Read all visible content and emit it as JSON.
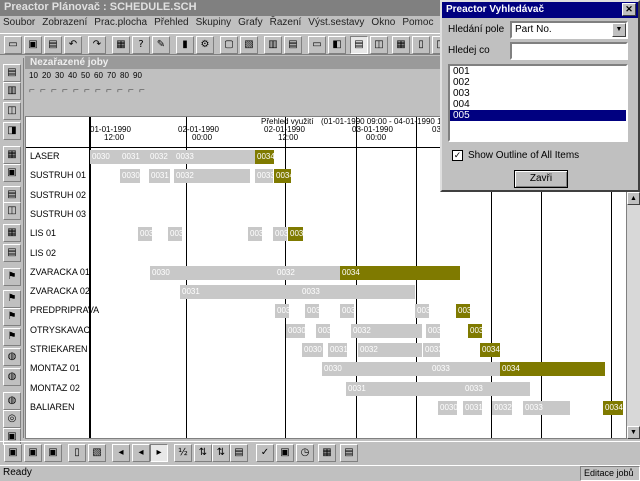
{
  "app": {
    "title": "Preactor Plánovač : SCHEDULE.SCH"
  },
  "menu": [
    "Soubor",
    "Zobrazení",
    "Prac.plocha",
    "Přehled",
    "Skupiny",
    "Grafy",
    "Řazení",
    "Výst.sestavy",
    "Okno",
    "Pomoc"
  ],
  "unscheduled": {
    "title": "Nezařazené joby",
    "ruler": [
      "10",
      "20",
      "30",
      "40",
      "50",
      "60",
      "70",
      "80",
      "90"
    ]
  },
  "gantt": {
    "header_title": "Přehled využití",
    "date_range": "(01-01-1990 09:00 - 04-01-1990 11:3",
    "dates": [
      {
        "d": "01-01-1990",
        "t": "12:00"
      },
      {
        "d": "02-01-1990",
        "t": "00:00"
      },
      {
        "d": "02-01-1990",
        "t": "12:00"
      },
      {
        "d": "03-01-1990",
        "t": "00:00"
      },
      {
        "d": "03-01-1990",
        "t": "12:00"
      }
    ],
    "resources": [
      "LASER",
      "SUSTRUH 01",
      "SUSTRUH 02",
      "SUSTRUH 03",
      "LIS 01",
      "LIS 02",
      "ZVARACKA 01",
      "ZVARACKA 02",
      "PREDPRIPRAVA",
      "OTRYSKAVAC",
      "STRIEKAREN",
      "MONTAZ 01",
      "MONTAZ 02",
      "BALIAREN"
    ],
    "bars": [
      {
        "r": 0,
        "s": 0,
        "e": 30,
        "l": "0030"
      },
      {
        "r": 0,
        "s": 30,
        "e": 58,
        "l": "0031"
      },
      {
        "r": 0,
        "s": 58,
        "e": 84,
        "l": "0032"
      },
      {
        "r": 0,
        "s": 84,
        "e": 165,
        "l": "0033"
      },
      {
        "r": 0,
        "s": 165,
        "e": 184,
        "l": "0034",
        "sel": true
      },
      {
        "r": 1,
        "s": 30,
        "e": 50,
        "l": "0030"
      },
      {
        "r": 1,
        "s": 59,
        "e": 80,
        "l": "0031"
      },
      {
        "r": 1,
        "s": 84,
        "e": 160,
        "l": "0032"
      },
      {
        "r": 1,
        "s": 165,
        "e": 183,
        "l": "0033"
      },
      {
        "r": 1,
        "s": 184,
        "e": 201,
        "l": "0034",
        "sel": true
      },
      {
        "r": 4,
        "s": 48,
        "e": 62,
        "l": "0030"
      },
      {
        "r": 4,
        "s": 78,
        "e": 92,
        "l": "0031"
      },
      {
        "r": 4,
        "s": 158,
        "e": 172,
        "l": "0032"
      },
      {
        "r": 4,
        "s": 183,
        "e": 197,
        "l": "0033"
      },
      {
        "r": 4,
        "s": 198,
        "e": 213,
        "l": "0034",
        "sel": true
      },
      {
        "r": 6,
        "s": 60,
        "e": 250,
        "l": "0030"
      },
      {
        "r": 6,
        "s": 185,
        "e": 250,
        "l": "0032"
      },
      {
        "r": 6,
        "s": 250,
        "e": 370,
        "l": "0034",
        "sel": true
      },
      {
        "r": 7,
        "s": 90,
        "e": 325,
        "l": "0031"
      },
      {
        "r": 7,
        "s": 210,
        "e": 325,
        "l": "0033"
      },
      {
        "r": 8,
        "s": 185,
        "e": 199,
        "l": "0030"
      },
      {
        "r": 8,
        "s": 215,
        "e": 229,
        "l": "0031"
      },
      {
        "r": 8,
        "s": 250,
        "e": 264,
        "l": "0032"
      },
      {
        "r": 8,
        "s": 325,
        "e": 339,
        "l": "0033"
      },
      {
        "r": 8,
        "s": 366,
        "e": 380,
        "l": "0034",
        "sel": true
      },
      {
        "r": 9,
        "s": 196,
        "e": 215,
        "l": "0030"
      },
      {
        "r": 9,
        "s": 226,
        "e": 240,
        "l": "0031"
      },
      {
        "r": 9,
        "s": 261,
        "e": 332,
        "l": "0032"
      },
      {
        "r": 9,
        "s": 336,
        "e": 350,
        "l": "0033"
      },
      {
        "r": 9,
        "s": 378,
        "e": 392,
        "l": "0034",
        "sel": true
      },
      {
        "r": 10,
        "s": 212,
        "e": 233,
        "l": "0030"
      },
      {
        "r": 10,
        "s": 238,
        "e": 257,
        "l": "0031"
      },
      {
        "r": 10,
        "s": 268,
        "e": 332,
        "l": "0032"
      },
      {
        "r": 10,
        "s": 333,
        "e": 350,
        "l": "0033"
      },
      {
        "r": 10,
        "s": 390,
        "e": 410,
        "l": "0034",
        "sel": true
      },
      {
        "r": 11,
        "s": 232,
        "e": 410,
        "l": "0030"
      },
      {
        "r": 11,
        "s": 340,
        "e": 410,
        "l": "0033"
      },
      {
        "r": 11,
        "s": 410,
        "e": 515,
        "l": "0034",
        "sel": true
      },
      {
        "r": 12,
        "s": 256,
        "e": 440,
        "l": "0031"
      },
      {
        "r": 12,
        "s": 373,
        "e": 440,
        "l": "0033"
      },
      {
        "r": 13,
        "s": 348,
        "e": 367,
        "l": "0030"
      },
      {
        "r": 13,
        "s": 373,
        "e": 392,
        "l": "0031"
      },
      {
        "r": 13,
        "s": 402,
        "e": 422,
        "l": "0032"
      },
      {
        "r": 13,
        "s": 433,
        "e": 480,
        "l": "0033"
      },
      {
        "r": 13,
        "s": 513,
        "e": 533,
        "l": "0034",
        "sel": true
      }
    ]
  },
  "dialog": {
    "title": "Preactor Vyhledávač",
    "field_label": "Hledání pole",
    "field_value": "Part No.",
    "search_label": "Hledej co",
    "search_value": "",
    "items": [
      "001",
      "002",
      "003",
      "004",
      "005"
    ],
    "selected": 4,
    "checkbox_label": "Show Outline of All Items",
    "close_btn": "Zavři"
  },
  "status": {
    "left": "Ready",
    "right": "Editace jobů"
  }
}
